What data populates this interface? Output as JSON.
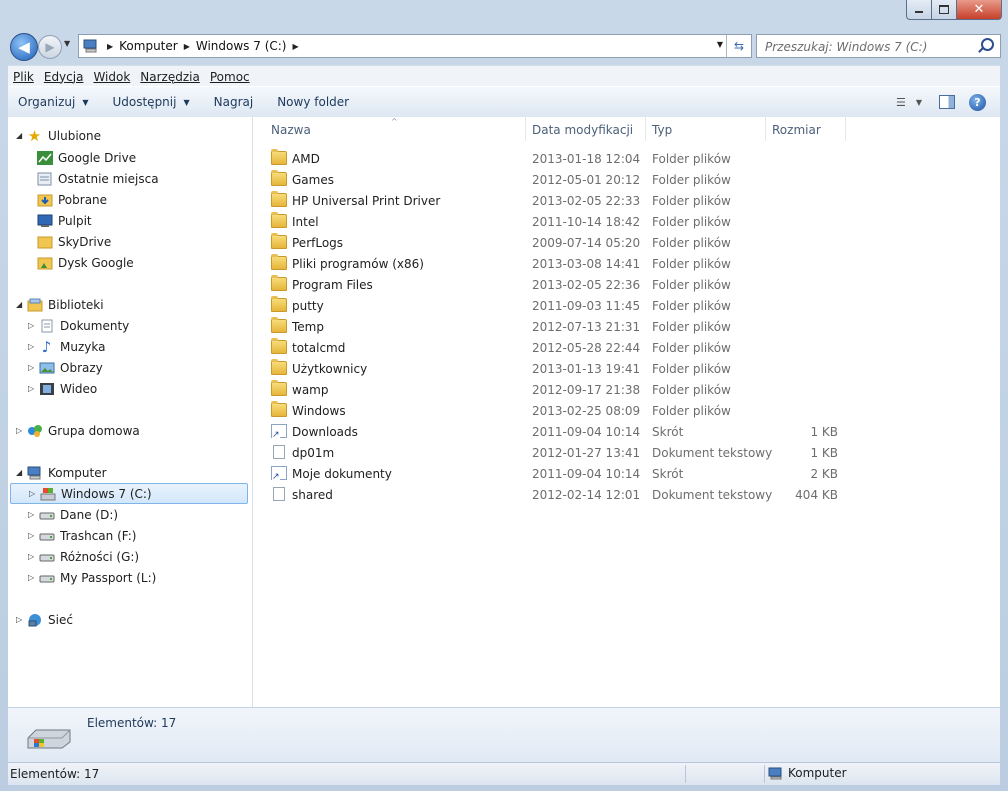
{
  "window": {
    "caption_buttons": {
      "minimize": "minimize-icon",
      "maximize": "maximize-icon",
      "close": "close-icon"
    }
  },
  "nav": {
    "breadcrumb": [
      "Komputer",
      "Windows 7 (C:)"
    ],
    "search_placeholder": "Przeszukaj: Windows 7 (C:)"
  },
  "menu": [
    "Plik",
    "Edycja",
    "Widok",
    "Narzędzia",
    "Pomoc"
  ],
  "toolbar": {
    "organize": "Organizuj",
    "share": "Udostępnij",
    "burn": "Nagraj",
    "new_folder": "Nowy folder"
  },
  "navpane": {
    "favorites": {
      "label": "Ulubione",
      "items": [
        "Google Drive",
        "Ostatnie miejsca",
        "Pobrane",
        "Pulpit",
        "SkyDrive",
        "Dysk Google"
      ]
    },
    "libraries": {
      "label": "Biblioteki",
      "items": [
        "Dokumenty",
        "Muzyka",
        "Obrazy",
        "Wideo"
      ]
    },
    "homegroup": {
      "label": "Grupa domowa"
    },
    "computer": {
      "label": "Komputer",
      "items": [
        "Windows 7 (C:)",
        "Dane (D:)",
        "Trashcan (F:)",
        "Różności (G:)",
        "My Passport (L:)"
      ],
      "selected": "Windows 7 (C:)"
    },
    "network": {
      "label": "Sieć"
    }
  },
  "columns": [
    "Nazwa",
    "Data modyfikacji",
    "Typ",
    "Rozmiar"
  ],
  "files": [
    {
      "name": "AMD",
      "date": "2013-01-18 12:04",
      "type": "Folder plików",
      "size": "",
      "icon": "folder"
    },
    {
      "name": "Games",
      "date": "2012-05-01 20:12",
      "type": "Folder plików",
      "size": "",
      "icon": "folder"
    },
    {
      "name": "HP Universal Print Driver",
      "date": "2013-02-05 22:33",
      "type": "Folder plików",
      "size": "",
      "icon": "folder"
    },
    {
      "name": "Intel",
      "date": "2011-10-14 18:42",
      "type": "Folder plików",
      "size": "",
      "icon": "folder"
    },
    {
      "name": "PerfLogs",
      "date": "2009-07-14 05:20",
      "type": "Folder plików",
      "size": "",
      "icon": "folder"
    },
    {
      "name": "Pliki programów (x86)",
      "date": "2013-03-08 14:41",
      "type": "Folder plików",
      "size": "",
      "icon": "folder"
    },
    {
      "name": "Program Files",
      "date": "2013-02-05 22:36",
      "type": "Folder plików",
      "size": "",
      "icon": "folder"
    },
    {
      "name": "putty",
      "date": "2011-09-03 11:45",
      "type": "Folder plików",
      "size": "",
      "icon": "folder"
    },
    {
      "name": "Temp",
      "date": "2012-07-13 21:31",
      "type": "Folder plików",
      "size": "",
      "icon": "folder"
    },
    {
      "name": "totalcmd",
      "date": "2012-05-28 22:44",
      "type": "Folder plików",
      "size": "",
      "icon": "folder"
    },
    {
      "name": "Użytkownicy",
      "date": "2013-01-13 19:41",
      "type": "Folder plików",
      "size": "",
      "icon": "folder"
    },
    {
      "name": "wamp",
      "date": "2012-09-17 21:38",
      "type": "Folder plików",
      "size": "",
      "icon": "folder"
    },
    {
      "name": "Windows",
      "date": "2013-02-25 08:09",
      "type": "Folder plików",
      "size": "",
      "icon": "folder"
    },
    {
      "name": "Downloads",
      "date": "2011-09-04 10:14",
      "type": "Skrót",
      "size": "1 KB",
      "icon": "shortcut"
    },
    {
      "name": "dp01m",
      "date": "2012-01-27 13:41",
      "type": "Dokument tekstowy",
      "size": "1 KB",
      "icon": "document"
    },
    {
      "name": "Moje dokumenty",
      "date": "2011-09-04 10:14",
      "type": "Skrót",
      "size": "2 KB",
      "icon": "shortcut"
    },
    {
      "name": "shared",
      "date": "2012-02-14 12:01",
      "type": "Dokument tekstowy",
      "size": "404 KB",
      "icon": "document"
    }
  ],
  "details": {
    "count": "Elementów: 17"
  },
  "status": {
    "left": "Elementów: 17",
    "right": "Komputer"
  }
}
